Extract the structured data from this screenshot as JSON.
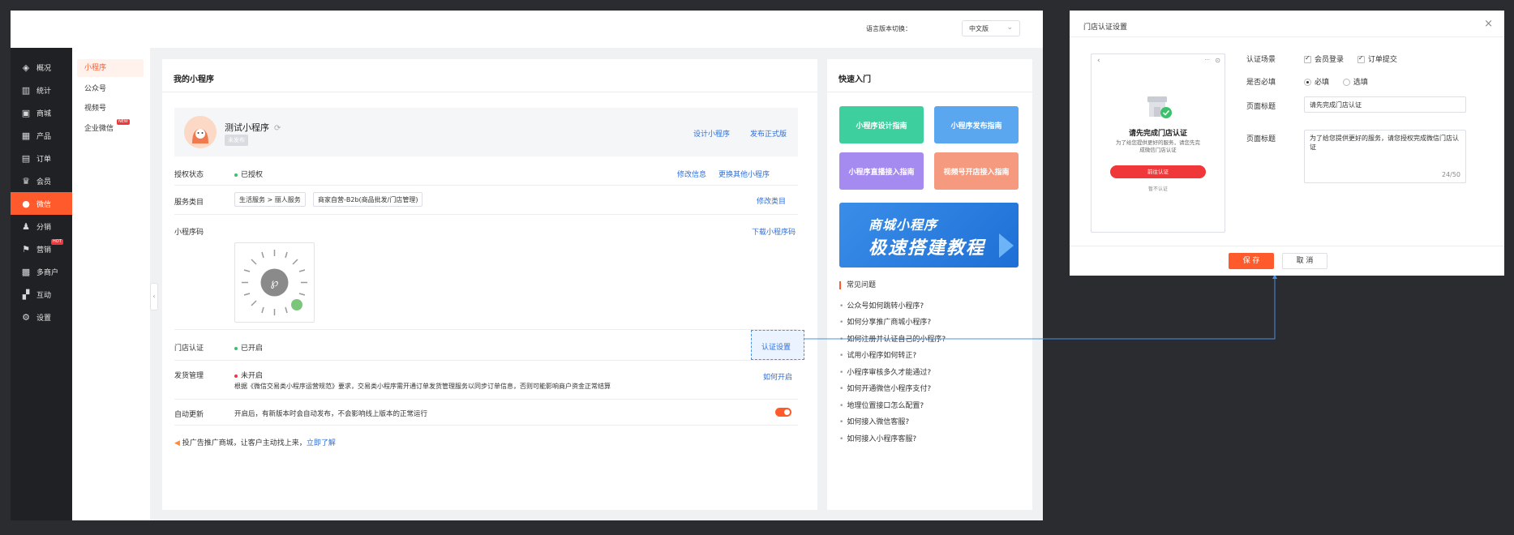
{
  "topbar": {
    "lang_label": "语言版本切换：",
    "lang_value": "中文版"
  },
  "sidebar": {
    "items": [
      {
        "label": "概况",
        "icon": "layers-icon"
      },
      {
        "label": "统计",
        "icon": "stats-icon"
      },
      {
        "label": "商城",
        "icon": "shop-icon"
      },
      {
        "label": "产品",
        "icon": "grid-icon"
      },
      {
        "label": "订单",
        "icon": "order-icon"
      },
      {
        "label": "会员",
        "icon": "crown-icon"
      },
      {
        "label": "微信",
        "icon": "wechat-icon"
      },
      {
        "label": "分销",
        "icon": "users-icon"
      },
      {
        "label": "营销",
        "icon": "flag-icon",
        "badge": "HOT"
      },
      {
        "label": "多商户",
        "icon": "store-icon"
      },
      {
        "label": "互动",
        "icon": "apps-icon"
      },
      {
        "label": "设置",
        "icon": "gear-icon"
      }
    ]
  },
  "subnav": {
    "items": [
      {
        "label": "小程序"
      },
      {
        "label": "公众号"
      },
      {
        "label": "视频号"
      },
      {
        "label": "企业微信",
        "badge": "NEW"
      }
    ]
  },
  "main": {
    "title": "我的小程序",
    "mini_name": "测试小程序",
    "mini_tag": "未发布",
    "design_link": "设计小程序",
    "publish_link": "发布正式版",
    "auth_label": "授权状态",
    "auth_value": "已授权",
    "auth_modify": "修改信息",
    "auth_change": "更换其他小程序",
    "service_label": "服务类目",
    "service_chip1": "生活服务 > 丽人服务",
    "service_chip2": "商家自营-B2b(商品批发/门店管理)",
    "service_modify": "修改类目",
    "qr_label": "小程序码",
    "qr_download": "下载小程序码",
    "store_label": "门店认证",
    "store_value": "已开启",
    "store_btn": "认证设置",
    "ship_label": "发货管理",
    "ship_value": "未开启",
    "ship_desc": "根据《微信交易类小程序运营规范》要求，交易类小程序需开通订单发货管理服务以同步订单信息，否则可能影响商户资金正常结算",
    "ship_how": "如何开启",
    "auto_label": "自动更新",
    "auto_desc": "开启后，有新版本时会自动发布，不会影响线上版本的正常运行",
    "promo_text": "投广告推广商城，让客户主动找上来，",
    "promo_link": "立即了解"
  },
  "quick": {
    "title": "快速入门",
    "tiles": [
      {
        "label": "小程序设计指南",
        "color": "#3ecf9e"
      },
      {
        "label": "小程序发布指南",
        "color": "#5aa7f0"
      },
      {
        "label": "小程序直播接入指南",
        "color": "#a58af0"
      },
      {
        "label": "视频号开店接入指南",
        "color": "#f59a7e"
      }
    ],
    "banner_line1": "商城小程序",
    "banner_line2": "极速搭建教程",
    "faq_title": "常见问题",
    "faq": [
      "公众号如何跳转小程序?",
      "如何分享推广商城小程序?",
      "如何注册并认证自己的小程序?",
      "试用小程序如何转正?",
      "小程序审核多久才能通过?",
      "如何开通微信小程序支付?",
      "地理位置接口怎么配置?",
      "如何接入微信客服?",
      "如何接入小程序客服?"
    ]
  },
  "modal": {
    "title": "门店认证设置",
    "phone_title": "请先完成门店认证",
    "phone_desc": "为了给您提供更好的服务，请您先完成微信门店认证",
    "phone_btn": "前往认证",
    "phone_skip": "暂不认证",
    "scene_label": "认证场景",
    "scene_opt1": "会员登录",
    "scene_opt2": "订单提交",
    "required_label": "是否必填",
    "required_opt1": "必填",
    "required_opt2": "选填",
    "page_title_label": "页面标题",
    "page_title_value": "请先完成门店认证",
    "page_desc_label": "页面标题",
    "page_desc_value": "为了给您提供更好的服务，请您授权完成微信门店认证",
    "page_desc_count": "24/50",
    "save_btn": "保 存",
    "cancel_btn": "取 消"
  }
}
